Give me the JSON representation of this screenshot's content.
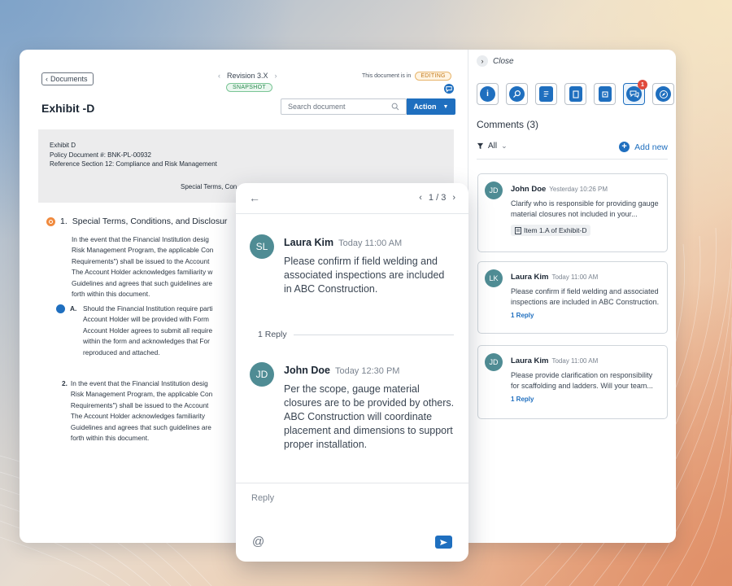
{
  "doc": {
    "back_label": "Documents",
    "revision": "Revision 3.X",
    "snapshot": "SNAPSHOT",
    "status_prefix": "This document is in",
    "status_badge": "EDITING",
    "title": "Exhibit -D",
    "search_placeholder": "Search document",
    "action_label": "Action",
    "header_lines": [
      "Exhibit D",
      "Policy Document #: BNK-PL-00932",
      "Reference Section 12: Compliance and Risk Management"
    ],
    "header_center": "Special Terms, Con",
    "section1_num": "1.",
    "section1_title": "Special Terms, Conditions, and Disclosur",
    "para1": "In the event that the Financial Institution desig\nRisk Management Program, the applicable Con\nRequirements\") shall be issued to the Account\nThe Account Holder acknowledges familiarity w\nGuidelines and agrees that such guidelines are\nforth within this document.",
    "subA_label": "A.",
    "subA_text": "Should the Financial Institution require parti\nAccount Holder will be provided with Form\nAccount Holder agrees to submit all require\nwithin the form and acknowledges that For\nreproduced and attached.",
    "item2_num": "2.",
    "item2_text": "In the event that the Financial Institution desig\nRisk Management Program, the applicable Con\nRequirements\") shall be issued to the Account\nThe Account Holder acknowledges familiarity \nGuidelines and agrees that such guidelines are\nforth within this document."
  },
  "side": {
    "close_label": "Close",
    "tools": [
      {
        "name": "info-icon",
        "glyph": "i"
      },
      {
        "name": "search-icon",
        "glyph": "⌕"
      },
      {
        "name": "document-icon",
        "glyph": "≡"
      },
      {
        "name": "clipboard-icon",
        "glyph": "▭"
      },
      {
        "name": "archive-icon",
        "glyph": "▣"
      },
      {
        "name": "comments-icon",
        "glyph": "☁",
        "badge": "1"
      },
      {
        "name": "compass-icon",
        "glyph": "◎"
      }
    ],
    "comments_heading": "Comments (3)",
    "filter_label": "All",
    "add_new": "Add new",
    "comments": [
      {
        "initials": "JD",
        "name": "John Doe",
        "time": "Yesterday 10:26 PM",
        "body": "Clarify who is responsible for providing gauge material closures not included in your...",
        "ref": "Item 1.A of Exhibit-D"
      },
      {
        "initials": "LK",
        "name": "Laura Kim",
        "time": "Today 11:00 AM",
        "body": "Please confirm if field welding and associated inspections are included in ABC Construction.",
        "reply": "1 Reply"
      },
      {
        "initials": "JD",
        "name": "Laura Kim",
        "time": "Today 11:00 AM",
        "body": "Please provide clarification on responsibility for scaffolding and ladders. Will your team...",
        "reply": "1 Reply"
      }
    ]
  },
  "thread": {
    "pager": "1 / 3",
    "messages": [
      {
        "initials": "SL",
        "name": "Laura Kim",
        "time": "Today 11:00 AM",
        "body": "Please confirm if field welding and associated inspections are included in ABC Construction."
      },
      {
        "initials": "JD",
        "name": "John Doe",
        "time": "Today 12:30 PM",
        "body": "Per the scope, gauge material closures are to be provided by others. ABC Construction will coordinate placement and dimensions to support proper installation."
      }
    ],
    "reply_count": "1 Reply",
    "reply_placeholder": "Reply"
  },
  "colors": {
    "accent": "#1f6fbf",
    "avatar": "#4f8c94",
    "badge": "#e04a3c",
    "editing": "#c2791a",
    "snapshot": "#2b8a4f"
  }
}
